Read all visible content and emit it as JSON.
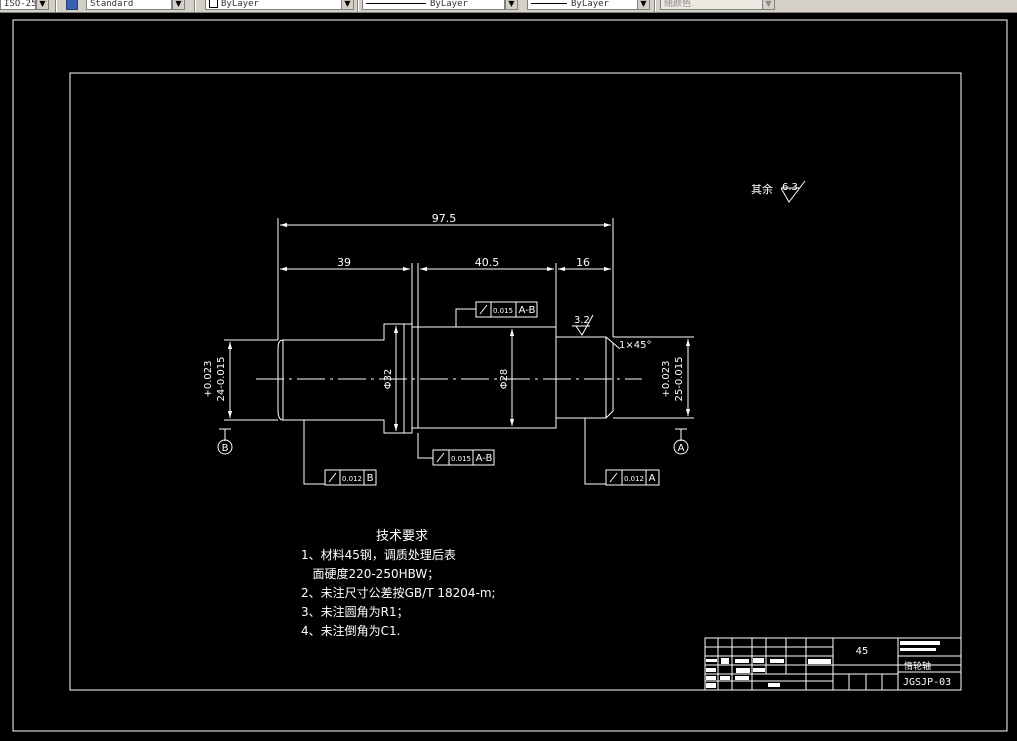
{
  "toolbar": {
    "dimstyle_value": "ISO-25",
    "textstyle_value": "Standard",
    "color_value": "ByLayer",
    "linetype_value": "ByLayer",
    "lineweight_value": "ByLayer",
    "plotstyle_value": "随颜色"
  },
  "drawing": {
    "dims": {
      "overall": "97.5",
      "left_len": "39",
      "mid_len": "40.5",
      "right_len": "16",
      "chamfer": "1×45°",
      "dia_left_tol_upper": "+0.023",
      "dia_left": "24-0.015",
      "dia_right_tol_upper": "+0.023",
      "dia_right": "25-0.015",
      "dia_flange": "Φ32",
      "dia_mid": "Φ28"
    },
    "roughness_local": "3.2",
    "roughness_rest_label": "其余",
    "roughness_rest_value": "6.3",
    "datums": {
      "left": "B",
      "right": "A"
    },
    "runout": {
      "top": {
        "value": "0.015",
        "datum": "A-B"
      },
      "flange": {
        "value": "0.015",
        "datum": "A-B"
      },
      "left": {
        "value": "0.012",
        "datum": "B"
      },
      "right": {
        "value": "0.012",
        "datum": "A"
      }
    },
    "notes": {
      "title": "技术要求",
      "lines": [
        "1、材料45钢，调质处理后表",
        "   面硬度220-250HBW；",
        "2、未注尺寸公差按GB/T 18204-m;",
        "3、未注圆角为R1；",
        "4、未注倒角为C1."
      ]
    },
    "title_block": {
      "material": "45",
      "part_name": "惰轮轴",
      "drawing_no": "JGSJP-03"
    }
  }
}
